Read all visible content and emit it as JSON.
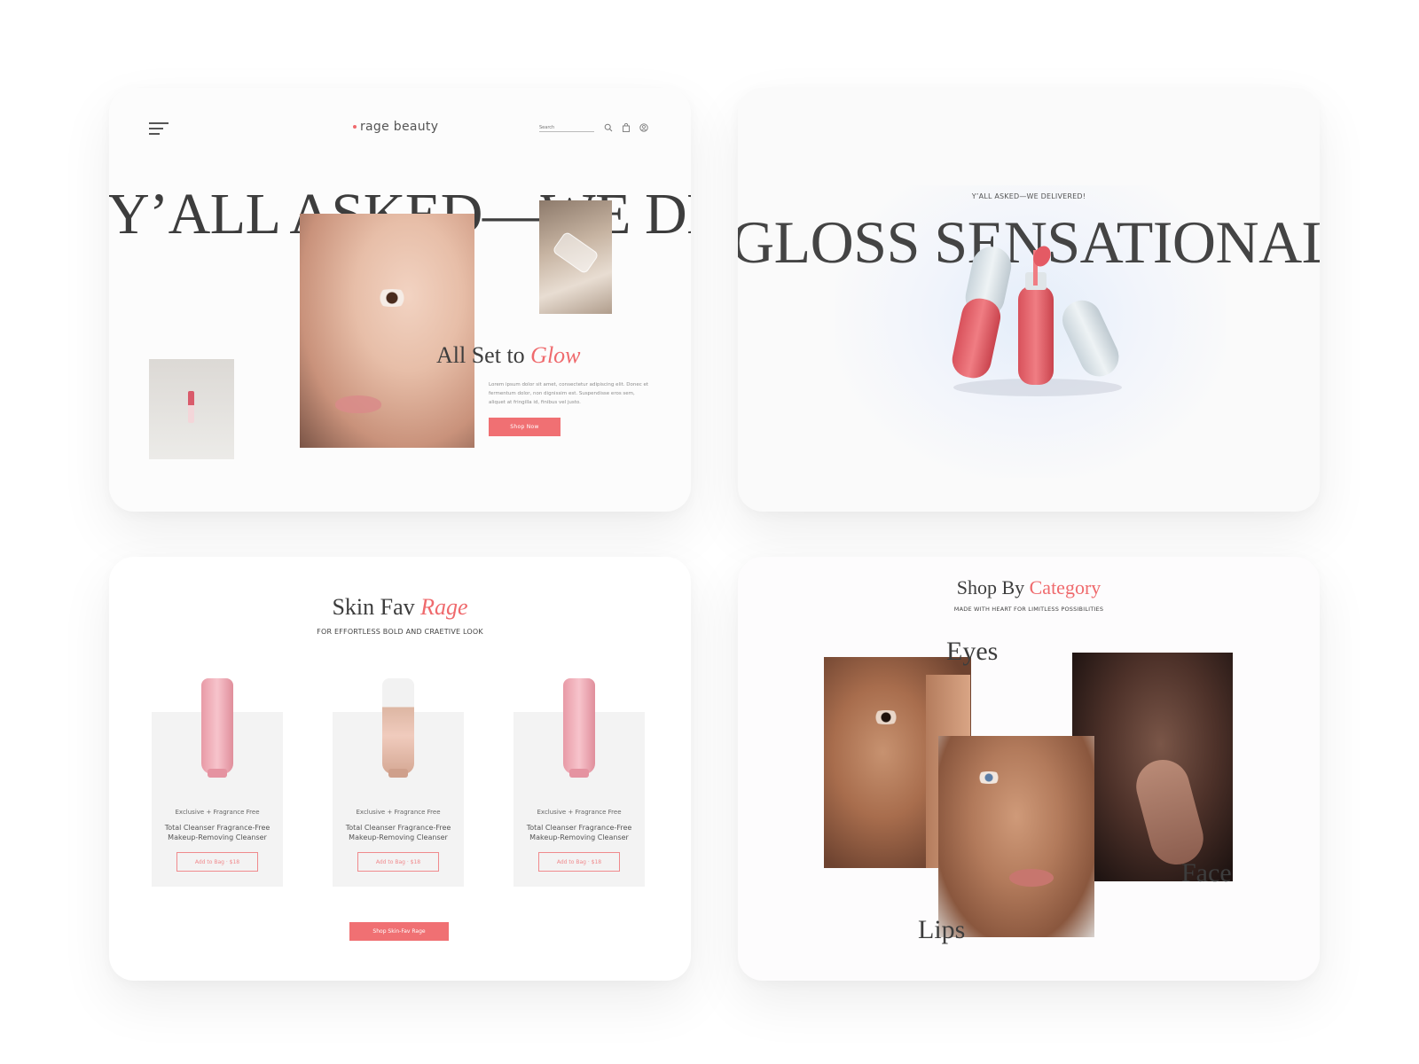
{
  "hero": {
    "logo": "rage beauty",
    "search_placeholder": "Search",
    "headline": "Y’ALL ASKED—WE DE",
    "glow_prefix": "All Set to ",
    "glow_accent": "Glow",
    "body": "Lorem ipsum dolor sit amet, consectetur adipiscing elit. Donec et fermentum dolor, non dignissim est. Suspendisse eros sem, aliquet at fringilla id, finibus vel justo.",
    "cta": "Shop Now"
  },
  "gloss": {
    "kicker": "Y’ALL ASKED—WE DELIVERED!",
    "headline": "GLOSS SENSATIONAL"
  },
  "skin": {
    "title_prefix": "Skin Fav ",
    "title_accent": "Rage",
    "subtitle": "FOR EFFORTLESS BOLD AND CRAETIVE LOOK",
    "products": [
      {
        "tag": "Exclusive + Fragrance Free",
        "name": "Total Cleanser Fragrance-Free Makeup-Removing Cleanser",
        "button": "Add to Bag · $18"
      },
      {
        "tag": "Exclusive + Fragrance Free",
        "name": "Total Cleanser Fragrance-Free Makeup-Removing Cleanser",
        "button": "Add to Bag · $18"
      },
      {
        "tag": "Exclusive + Fragrance Free",
        "name": "Total Cleanser Fragrance-Free Makeup-Removing Cleanser",
        "button": "Add to Bag · $18"
      }
    ],
    "cta": "Shop Skin-Fav Rage"
  },
  "category": {
    "title_prefix": "Shop By ",
    "title_accent": "Category",
    "subtitle": "MADE WITH HEART FOR LIMITLESS POSSIBILITIES",
    "labels": {
      "eyes": "Eyes",
      "face": "Face",
      "lips": "Lips"
    }
  },
  "colors": {
    "accent": "#ef6a6d",
    "text": "#3d3d3d",
    "card": "#fcfcfc"
  }
}
